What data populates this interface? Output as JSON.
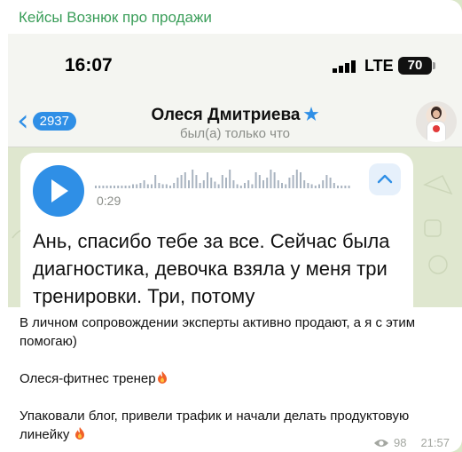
{
  "channel": {
    "title": "Кейсы Вознюк про продажи"
  },
  "status_bar": {
    "time": "16:07",
    "network": "LTE",
    "battery": "70"
  },
  "chat_header": {
    "back_count": "2937",
    "contact_name": "Олеся Дмитриева",
    "contact_status": "был(а) только что"
  },
  "voice_message": {
    "duration": "0:29",
    "transcript": "Ань, спасибо тебе за все. Сейчас была диагностика, девочка взяла у меня три тренировки. Три, потому"
  },
  "caption": {
    "line1": "В личном сопровождении эксперты активно продают, а я с этим помогаю)",
    "line2": "Олеся-фитнес тренер",
    "line3": "Упаковали блог, привели трафик и начали делать продуктовую линейку"
  },
  "post_meta": {
    "views": "98",
    "time": "21:57"
  },
  "colors": {
    "accent": "#2f8fe6",
    "channel_title": "#3b9e5a"
  },
  "icons": [
    "back-chevron-icon",
    "verified-star-icon",
    "play-icon",
    "chevron-up-icon",
    "signal-icon",
    "fire-icon",
    "eye-icon"
  ]
}
